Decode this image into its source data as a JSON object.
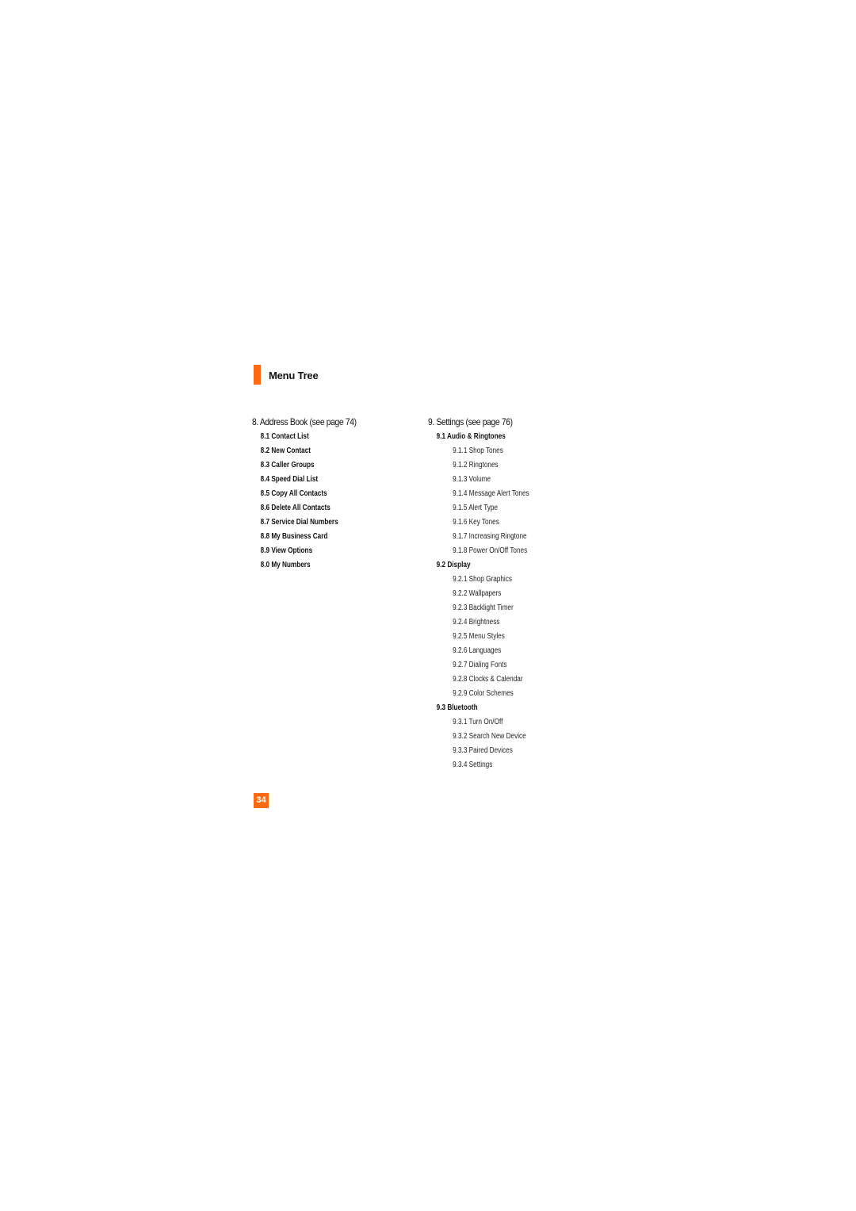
{
  "section": {
    "title": "Menu Tree",
    "accent_color": "#ff6a13"
  },
  "address_book": {
    "heading": "8. Address Book (see page 74)",
    "items": [
      "8.1 Contact List",
      "8.2 New Contact",
      "8.3 Caller Groups",
      "8.4 Speed Dial List",
      "8.5 Copy All Contacts",
      "8.6 Delete All Contacts",
      "8.7 Service Dial Numbers",
      "8.8 My Business Card",
      "8.9 View Options",
      "8.0 My Numbers"
    ]
  },
  "settings": {
    "heading": "9. Settings (see page 76)",
    "groups": [
      {
        "label": "9.1 Audio & Ringtones",
        "items": [
          "9.1.1 Shop Tones",
          "9.1.2 Ringtones",
          "9.1.3 Volume",
          "9.1.4 Message Alert Tones",
          "9.1.5 Alert Type",
          "9.1.6 Key Tones",
          "9.1.7 Increasing Ringtone",
          "9.1.8 Power On/Off Tones"
        ]
      },
      {
        "label": "9.2 Display",
        "items": [
          "9.2.1 Shop Graphics",
          "9.2.2 Wallpapers",
          "9.2.3 Backlight Timer",
          "9.2.4 Brightness",
          "9.2.5 Menu Styles",
          "9.2.6 Languages",
          "9.2.7 Dialing Fonts",
          "9.2.8 Clocks & Calendar",
          "9.2.9 Color Schemes"
        ]
      },
      {
        "label": "9.3 Bluetooth",
        "items": [
          "9.3.1 Turn On/Off",
          "9.3.2 Search New Device",
          "9.3.3 Paired Devices",
          "9.3.4 Settings"
        ]
      }
    ]
  },
  "page_number": "34"
}
